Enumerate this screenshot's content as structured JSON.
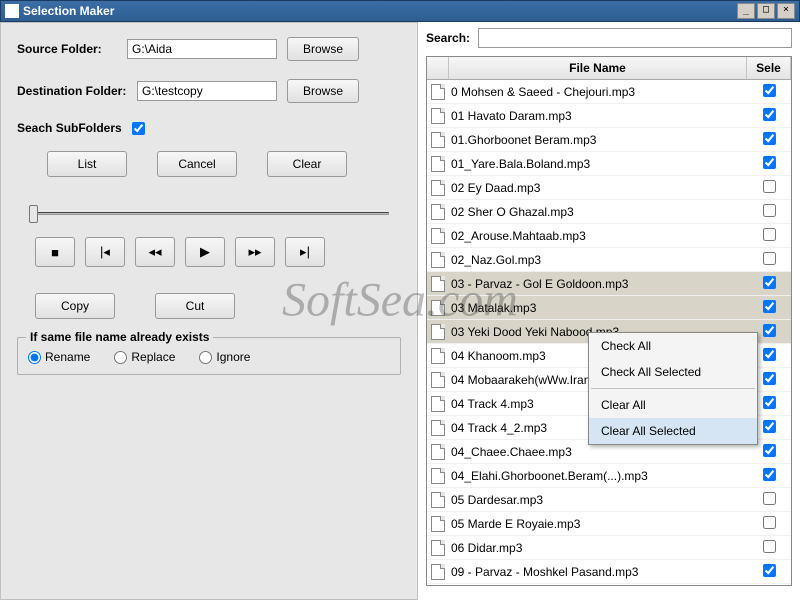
{
  "window": {
    "title": "Selection Maker"
  },
  "left": {
    "source_label": "Source Folder:",
    "source_value": "G:\\Aida",
    "dest_label": "Destination Folder:",
    "dest_value": "G:\\testcopy",
    "browse": "Browse",
    "subfolders_label": "Seach SubFolders",
    "subfolders_checked": true,
    "list_btn": "List",
    "cancel_btn": "Cancel",
    "clear_btn": "Clear",
    "copy_btn": "Copy",
    "cut_btn": "Cut",
    "group_legend": "If same file name already exists",
    "radios": {
      "rename": "Rename",
      "replace": "Replace",
      "ignore": "Ignore"
    },
    "radio_selected": "rename"
  },
  "right": {
    "search_label": "Search:",
    "search_value": "",
    "col_name": "File Name",
    "col_sel": "Sele",
    "rows": [
      {
        "name": "0 Mohsen & Saeed - Chejouri.mp3",
        "checked": true,
        "sel": false
      },
      {
        "name": "01 Havato Daram.mp3",
        "checked": true,
        "sel": false
      },
      {
        "name": "01.Ghorboonet Beram.mp3",
        "checked": true,
        "sel": false
      },
      {
        "name": "01_Yare.Bala.Boland.mp3",
        "checked": true,
        "sel": false
      },
      {
        "name": "02 Ey Daad.mp3",
        "checked": false,
        "sel": false
      },
      {
        "name": "02 Sher O Ghazal.mp3",
        "checked": false,
        "sel": false
      },
      {
        "name": "02_Arouse.Mahtaab.mp3",
        "checked": false,
        "sel": false
      },
      {
        "name": "02_Naz.Gol.mp3",
        "checked": false,
        "sel": false
      },
      {
        "name": "03 - Parvaz - Gol E Goldoon.mp3",
        "checked": true,
        "sel": true
      },
      {
        "name": "03 Matalak.mp3",
        "checked": true,
        "sel": true
      },
      {
        "name": "03 Yeki Dood Yeki Nabood.mp3",
        "checked": true,
        "sel": true
      },
      {
        "name": "04 Khanoom.mp3",
        "checked": true,
        "sel": false
      },
      {
        "name": "04 Mobaarakeh(wWw.Iran2...",
        "checked": true,
        "sel": false
      },
      {
        "name": "04 Track 4.mp3",
        "checked": true,
        "sel": false
      },
      {
        "name": "04 Track 4_2.mp3",
        "checked": true,
        "sel": false
      },
      {
        "name": "04_Chaee.Chaee.mp3",
        "checked": true,
        "sel": false
      },
      {
        "name": "04_Elahi.Ghorboonet.Beram(...).mp3",
        "checked": true,
        "sel": false
      },
      {
        "name": "05 Dardesar.mp3",
        "checked": false,
        "sel": false
      },
      {
        "name": "05 Marde E Royaie.mp3",
        "checked": false,
        "sel": false
      },
      {
        "name": "06 Didar.mp3",
        "checked": false,
        "sel": false
      },
      {
        "name": "09 - Parvaz - Moshkel Pasand.mp3",
        "checked": true,
        "sel": false
      }
    ]
  },
  "context_menu": {
    "check_all": "Check All",
    "check_all_selected": "Check All Selected",
    "clear_all": "Clear All",
    "clear_all_selected": "Clear All Selected"
  },
  "watermark": "SoftSea.com"
}
